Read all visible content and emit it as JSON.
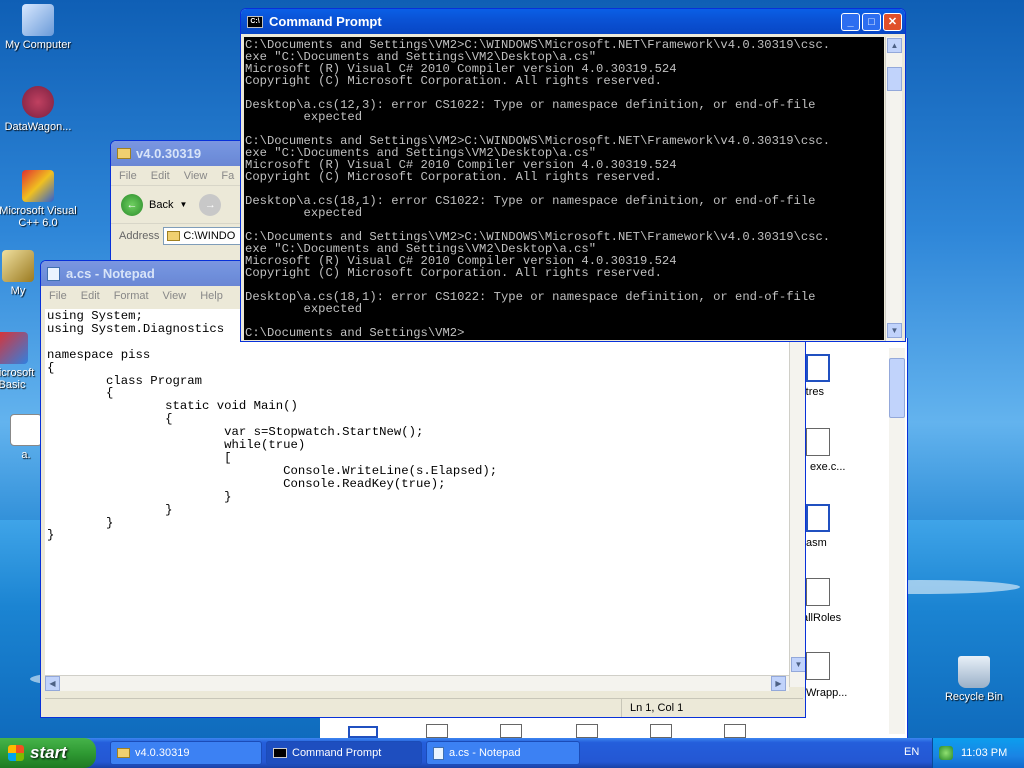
{
  "desktop": {
    "icons": [
      {
        "label": "My Computer"
      },
      {
        "label": "DataWagon..."
      },
      {
        "label": "Microsoft Visual C++ 6.0"
      },
      {
        "label": "My"
      },
      {
        "label": "Microsoft Basic"
      },
      {
        "label": "a."
      },
      {
        "label": "Recycle Bin"
      }
    ],
    "behind_labels": [
      "rtres",
      "exe.c...",
      "asm",
      "allRoles",
      "Wrapp..."
    ]
  },
  "explorer": {
    "title": "v4.0.30319",
    "menu": [
      "File",
      "Edit",
      "View",
      "Fa"
    ],
    "back_label": "Back",
    "address_label": "Address",
    "address_value": "C:\\WINDO"
  },
  "cmd": {
    "title": "Command Prompt",
    "output": "C:\\Documents and Settings\\VM2>C:\\WINDOWS\\Microsoft.NET\\Framework\\v4.0.30319\\csc.\nexe \"C:\\Documents and Settings\\VM2\\Desktop\\a.cs\"\nMicrosoft (R) Visual C# 2010 Compiler version 4.0.30319.524\nCopyright (C) Microsoft Corporation. All rights reserved.\n\nDesktop\\a.cs(12,3): error CS1022: Type or namespace definition, or end-of-file\n        expected\n\nC:\\Documents and Settings\\VM2>C:\\WINDOWS\\Microsoft.NET\\Framework\\v4.0.30319\\csc.\nexe \"C:\\Documents and Settings\\VM2\\Desktop\\a.cs\"\nMicrosoft (R) Visual C# 2010 Compiler version 4.0.30319.524\nCopyright (C) Microsoft Corporation. All rights reserved.\n\nDesktop\\a.cs(18,1): error CS1022: Type or namespace definition, or end-of-file\n        expected\n\nC:\\Documents and Settings\\VM2>C:\\WINDOWS\\Microsoft.NET\\Framework\\v4.0.30319\\csc.\nexe \"C:\\Documents and Settings\\VM2\\Desktop\\a.cs\"\nMicrosoft (R) Visual C# 2010 Compiler version 4.0.30319.524\nCopyright (C) Microsoft Corporation. All rights reserved.\n\nDesktop\\a.cs(18,1): error CS1022: Type or namespace definition, or end-of-file\n        expected\n\nC:\\Documents and Settings\\VM2>"
  },
  "notepad": {
    "title": "a.cs - Notepad",
    "menu": [
      "File",
      "Edit",
      "Format",
      "View",
      "Help"
    ],
    "content": "using System;\nusing System.Diagnostics\n\nnamespace piss\n{\n        class Program\n        {\n                static void Main()\n                {\n                        var s=Stopwatch.StartNew();\n                        while(true)\n                        [\n                                Console.WriteLine(s.Elapsed);\n                                Console.ReadKey(true);\n                        }\n                }\n        }\n}",
    "status": "Ln 1, Col 1"
  },
  "taskbar": {
    "start_label": "start",
    "tasks": [
      "v4.0.30319",
      "Command Prompt",
      "a.cs - Notepad"
    ],
    "lang": "EN",
    "clock": "11:03 PM"
  }
}
